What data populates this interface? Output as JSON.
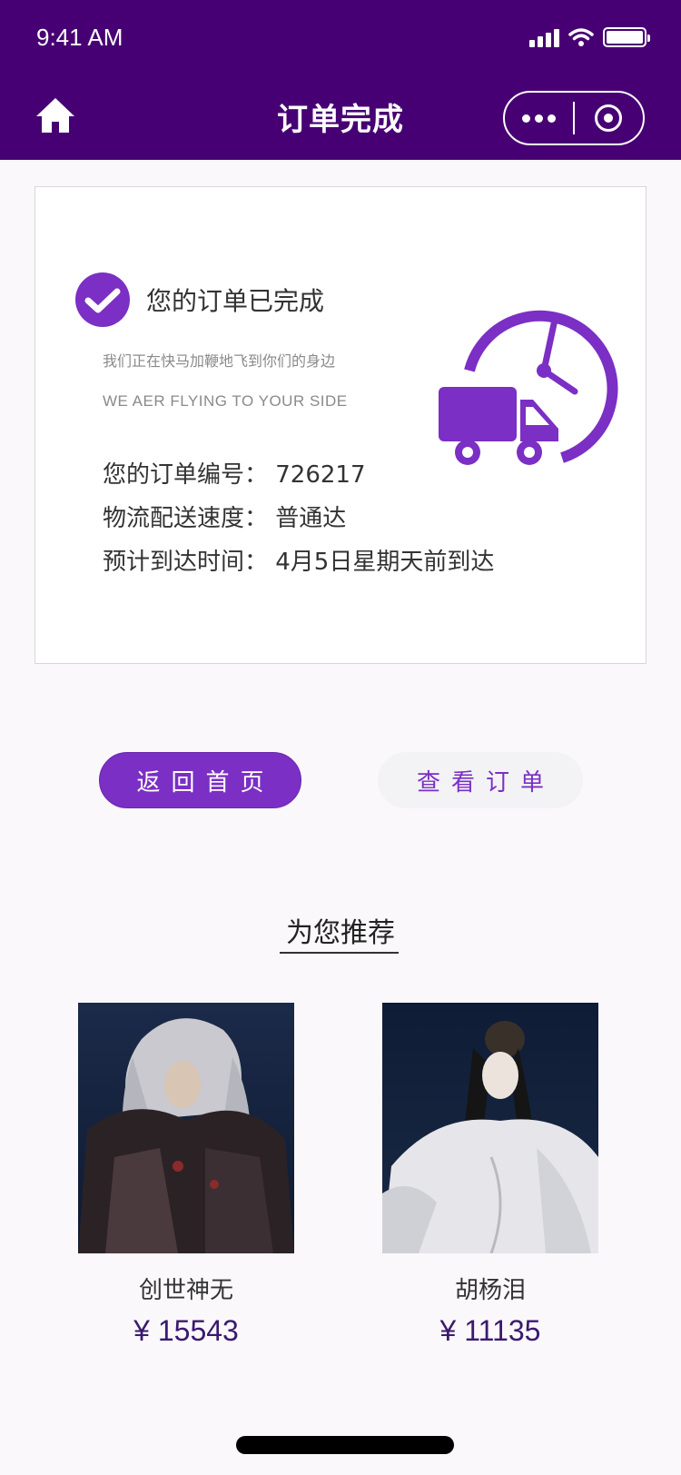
{
  "status_bar": {
    "time": "9:41 AM"
  },
  "nav": {
    "title": "订单完成"
  },
  "order": {
    "status_text": "您的订单已完成",
    "sub_cn": "我们正在快马加鞭地飞到你们的身边",
    "sub_en": "WE AER FLYING TO YOUR SIDE",
    "number_line": "您的订单编号：  726217",
    "speed_line": "物流配送速度：  普通达",
    "eta_line": "预计到达时间：  4月5日星期天前到达"
  },
  "actions": {
    "back_home_label": "返回首页",
    "view_order_label": "查看订单"
  },
  "recommend": {
    "title": "为您推荐",
    "products": [
      {
        "name": "创世神无",
        "price": "¥ 15543"
      },
      {
        "name": "胡杨泪",
        "price": "¥ 11135"
      }
    ]
  },
  "colors": {
    "header_bg": "#470073",
    "accent": "#7b2fc4",
    "price": "#3a1a6e"
  },
  "icons": [
    "home-icon",
    "more-dots-icon",
    "target-icon",
    "check-circle-icon",
    "delivery-truck-clock-icon"
  ]
}
